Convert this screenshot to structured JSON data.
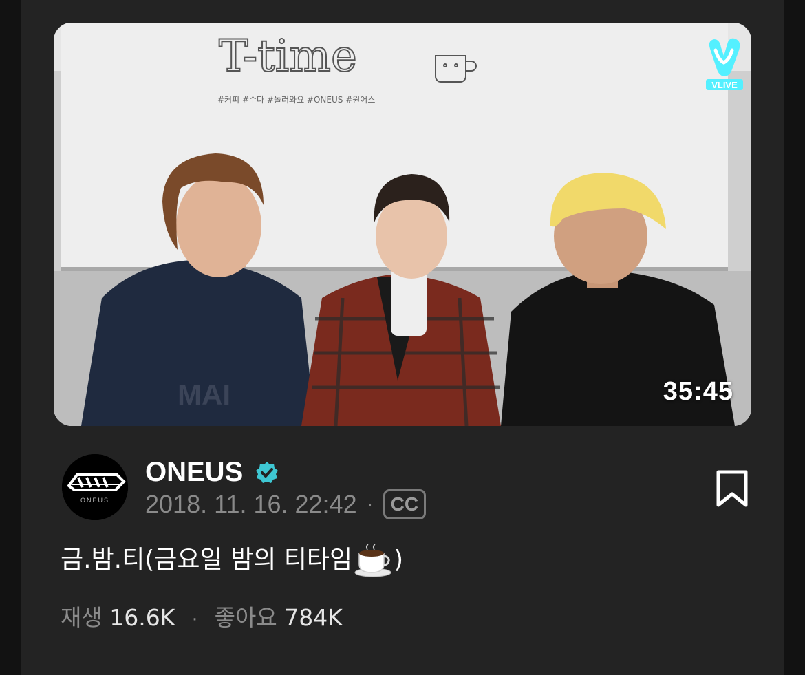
{
  "video": {
    "duration": "35:45",
    "badge": "VLIVE",
    "thumbnail_board_title": "T-time",
    "thumbnail_board_tags": "#커피   #수다   #놀러와요   #ONEUS   #원어스",
    "thumbnail_sweater_text": "MAI"
  },
  "channel": {
    "name": "ONEUS",
    "avatar_text": "ONEUS",
    "date": "2018. 11. 16. 22:42",
    "separator": "·",
    "cc_label": "CC"
  },
  "post": {
    "title_text": "금.밤.티(금요일 밤의 티타임",
    "title_emoji": "coffee-cup-icon",
    "title_suffix": ")"
  },
  "stats": {
    "views_label": "재생",
    "views_value": "16.6K",
    "separator": "·",
    "likes_label": "좋아요",
    "likes_value": "784K"
  },
  "colors": {
    "background": "#121212",
    "card": "#232323",
    "muted_text": "#8a8a8a",
    "verified": "#3ec7d3",
    "vlive": "#54f0ff"
  }
}
